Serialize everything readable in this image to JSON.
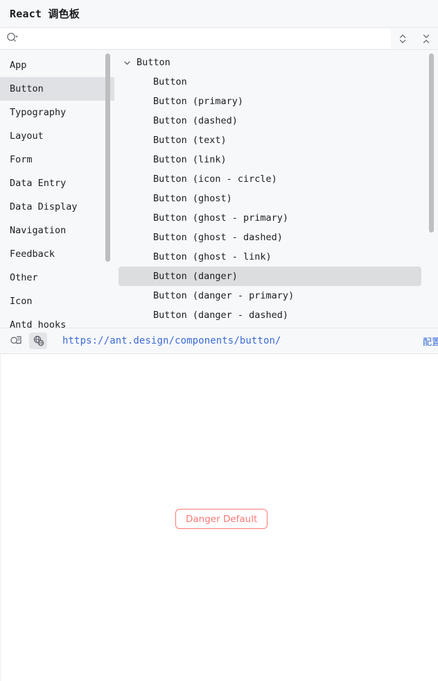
{
  "window": {
    "title": "React 调色板"
  },
  "search": {
    "value": "",
    "placeholder": "",
    "icon": "search-dropdown-icon",
    "expand_all_label": "expand-all-icon",
    "collapse_all_label": "collapse-all-icon"
  },
  "sidebar": {
    "items": [
      {
        "label": "App",
        "selected": false
      },
      {
        "label": "Button",
        "selected": true
      },
      {
        "label": "Typography",
        "selected": false
      },
      {
        "label": "Layout",
        "selected": false
      },
      {
        "label": "Form",
        "selected": false
      },
      {
        "label": "Data Entry",
        "selected": false
      },
      {
        "label": "Data Display",
        "selected": false
      },
      {
        "label": "Navigation",
        "selected": false
      },
      {
        "label": "Feedback",
        "selected": false
      },
      {
        "label": "Other",
        "selected": false
      },
      {
        "label": "Icon",
        "selected": false
      },
      {
        "label": "Antd hooks",
        "selected": false
      }
    ]
  },
  "list": {
    "group": {
      "label": "Button",
      "expanded": true,
      "chevron": "chevron-down-icon"
    },
    "items": [
      {
        "label": "Button",
        "selected": false
      },
      {
        "label": "Button (primary)",
        "selected": false
      },
      {
        "label": "Button (dashed)",
        "selected": false
      },
      {
        "label": "Button (text)",
        "selected": false
      },
      {
        "label": "Button (link)",
        "selected": false
      },
      {
        "label": "Button (icon - circle)",
        "selected": false
      },
      {
        "label": "Button (ghost)",
        "selected": false
      },
      {
        "label": "Button (ghost - primary)",
        "selected": false
      },
      {
        "label": "Button (ghost - dashed)",
        "selected": false
      },
      {
        "label": "Button (ghost - link)",
        "selected": false
      },
      {
        "label": "Button (danger)",
        "selected": true
      },
      {
        "label": "Button (danger - primary)",
        "selected": false
      },
      {
        "label": "Button (danger - dashed)",
        "selected": false
      }
    ]
  },
  "urlbar": {
    "url": "https://ant.design/components/button/",
    "config_label": "配置",
    "tools": [
      {
        "name": "inspect-icon",
        "active": false
      },
      {
        "name": "browser-globe-icon",
        "active": true
      }
    ]
  },
  "preview": {
    "button_label": "Danger Default"
  },
  "colors": {
    "accent_link": "#3a6bd8",
    "danger": "#ff7875",
    "panel_bg": "#f7f8fa",
    "selection": "#dcdddf",
    "sidebar_selection": "#dfe1e5"
  }
}
